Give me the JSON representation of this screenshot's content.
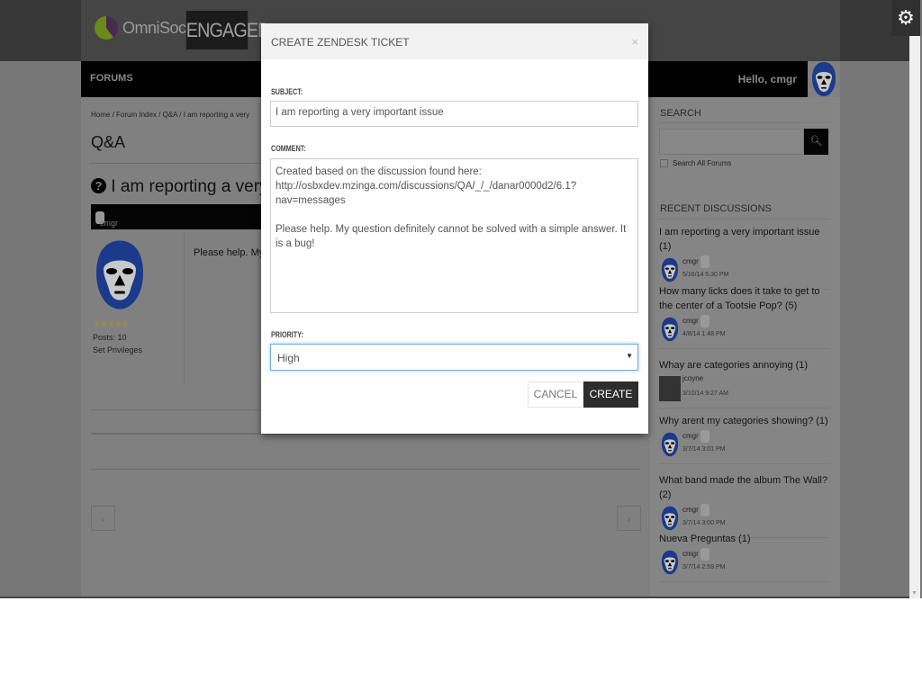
{
  "header": {
    "brand": "OmniSocial",
    "product": "ENGAGED"
  },
  "nav": {
    "forums": "FORUMS",
    "greeting": "Hello, cmgr"
  },
  "breadcrumb": "Home / Forum Index / Q&A / I am reporting a very",
  "page_title": "Q&A",
  "question": {
    "icon": "question-circle-icon",
    "title": "I am reporting a very im"
  },
  "post": {
    "author": "cmgr",
    "posts": "Posts: 10",
    "set_privileges": "Set Privileges",
    "text": "Please help. My q"
  },
  "pager": {
    "prev": "‹",
    "next": "›"
  },
  "sidebar": {
    "search_heading": "SEARCH",
    "search_value": "",
    "search_all": "Search All Forums",
    "recent_heading": "RECENT DISCUSSIONS",
    "discussions": [
      {
        "title": "I am reporting a very important issue (1)",
        "user": "cmgr",
        "date": "5/16/14 5:30 PM"
      },
      {
        "title": "How many licks does it take to get to the center of a Tootsie Pop? (5)",
        "user": "cmgr",
        "date": "4/8/14 1:48 PM"
      },
      {
        "title": "Whay are categories annoying (1)",
        "user": "jcoyne",
        "date": "3/10/14 9:27 AM"
      },
      {
        "title": "Why arent my categories showing? (1)",
        "user": "cmgr",
        "date": "3/7/14 3:01 PM"
      },
      {
        "title": "What band made the album The Wall? (2)",
        "user": "cmgr",
        "date": "3/7/14 3:00 PM"
      },
      {
        "title": "Nueva Preguntas (1)",
        "user": "cmgr",
        "date": "3/7/14 2:59 PM"
      }
    ]
  },
  "modal": {
    "title": "CREATE ZENDESK TICKET",
    "close": "×",
    "subject_label": "SUBJECT:",
    "subject_value": "I am reporting a very important issue",
    "comment_label": "COMMENT:",
    "comment_value": "Created based on the discussion found here:\nhttp://osbxdev.mzinga.com/discussions/QA/_/_/danar0000d2/6.1?nav=messages\n\nPlease help. My question definitely cannot be solved with a simple answer. It is a bug!",
    "priority_label": "PRIORITY:",
    "priority_value": "High",
    "cancel": "CANCEL",
    "create": "CREATE"
  },
  "colors": {
    "mask_blue": "#1c3a8a",
    "create_button": "#2d2d2d",
    "focus_border": "#66afe9"
  }
}
